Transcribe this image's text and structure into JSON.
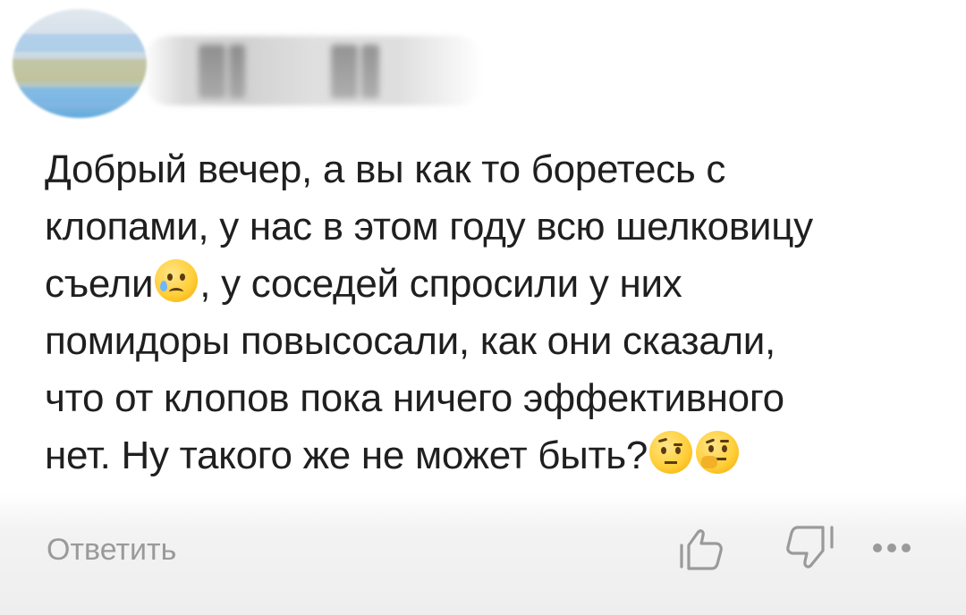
{
  "comment": {
    "lines": [
      "Добрый вечер, а вы как то боретесь с",
      "клопами, у нас в этом году всю шелковицу",
      "съели",
      ", у соседей спросили у них",
      "помидоры повысосали, как они сказали,",
      "что от клопов пока ничего эффективного",
      "нет. Ну такого же не может быть?"
    ]
  },
  "actions": {
    "reply_label": "Ответить"
  },
  "icons": {
    "emoji_1": "sad-tear-emoji",
    "emoji_2": "raised-eyebrow-emoji",
    "emoji_3": "thinking-face-emoji",
    "like": "thumbs-up-outline-icon",
    "dislike": "thumbs-down-outline-icon",
    "more": "more-dots-icon"
  }
}
